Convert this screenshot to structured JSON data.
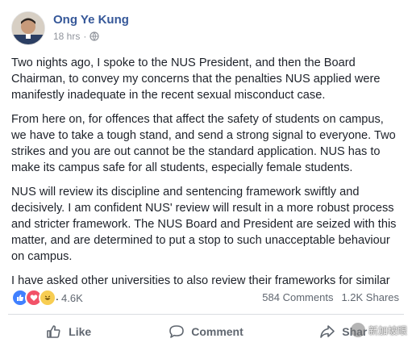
{
  "post": {
    "author": "Ong Ye Kung",
    "time": "18 hrs",
    "privacy_icon": "globe-icon",
    "paragraphs": [
      "Two nights ago, I spoke to the NUS President, and then the Board Chairman, to convey my concerns that the penalties NUS applied were manifestly inadequate in the recent sexual misconduct case.",
      "From here on, for offences that affect the safety of students on campus, we have to take a tough stand, and send a strong signal to everyone. Two strikes and you are out cannot be the standard application. NUS has to make its campus safe for all students, especially female students.",
      "NUS will review its discipline and sentencing framework swiftly and decisively. I am confident NUS' review will result in a more robust process and stricter framework. The NUS Board and President are seized with this matter, and are determined to put a stop to such unacceptable behaviour on campus.",
      "I have asked other universities to also review their frameworks for similar offences."
    ]
  },
  "stats": {
    "reactions_count": "4.6K",
    "reaction_icons": [
      "like-icon",
      "love-icon",
      "haha-icon"
    ],
    "comments": "584 Comments",
    "shares": "1.2K Shares"
  },
  "actions": {
    "like": "Like",
    "comment": "Comment",
    "share": "Shar"
  },
  "watermark": {
    "text": "新加坡眼"
  },
  "colors": {
    "author_link": "#365899",
    "meta": "#90949c",
    "like_reaction": "#4080ff",
    "love_reaction": "#f25268",
    "haha_reaction": "#f7cd52"
  }
}
